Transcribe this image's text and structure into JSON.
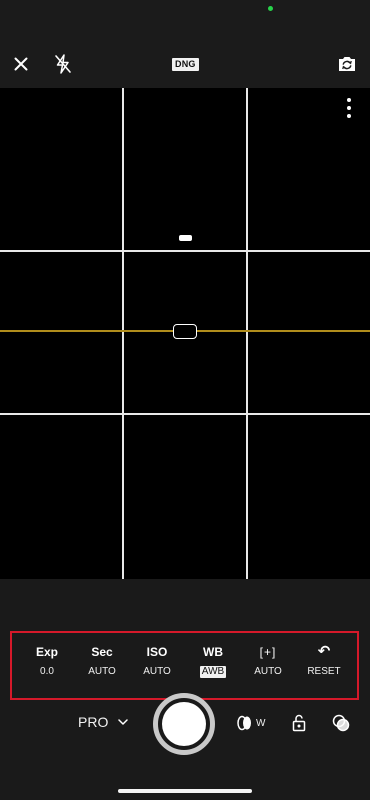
{
  "top_bar": {
    "format_badge": "DNG",
    "icons": [
      "close-icon",
      "flash-off-icon",
      "switch-camera-icon"
    ]
  },
  "viewfinder": {
    "icons": [
      "more-vertical-icon",
      "level-indicator",
      "focus-marker"
    ],
    "grid": "3x3",
    "level_line_color": "#b08d1c"
  },
  "settings": [
    {
      "name": "Exp",
      "value": "0.0"
    },
    {
      "name": "Sec",
      "value": "AUTO"
    },
    {
      "name": "ISO",
      "value": "AUTO"
    },
    {
      "name": "WB",
      "value": "AWB"
    },
    {
      "name": "[+]",
      "value": "AUTO"
    },
    {
      "name": "↶",
      "value": "RESET"
    }
  ],
  "bottom": {
    "mode_label": "PRO",
    "lens_label": "W",
    "icons": [
      "chevron-down-icon",
      "shutter-button",
      "lens-icon",
      "lock-icon",
      "filter-icon"
    ]
  },
  "colors": {
    "highlight_border": "#d5192a",
    "privacy_dot": "#27d34a"
  }
}
